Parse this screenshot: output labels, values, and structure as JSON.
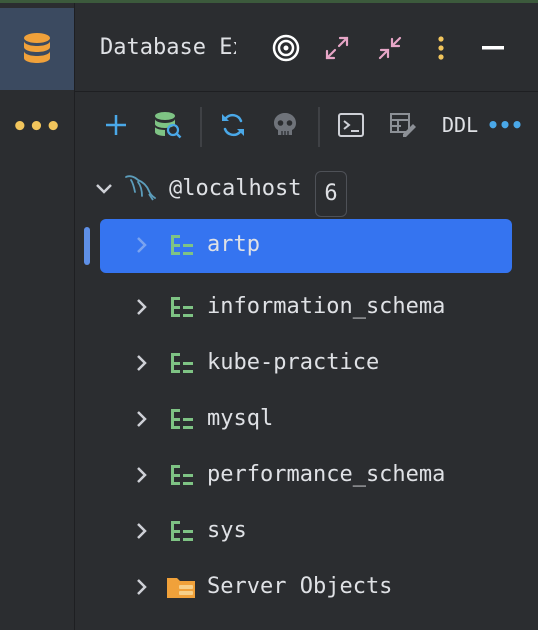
{
  "activity_bar": {
    "more_label": "•••"
  },
  "panel": {
    "title": "Database Explorer",
    "header_icons": [
      "target-icon",
      "expand-icon",
      "collapse-icon",
      "kebab-icon",
      "minimize-icon"
    ]
  },
  "toolbar": {
    "ddl_label": "DDL",
    "more_label": "•••"
  },
  "tree": {
    "connection": {
      "label": "@localhost",
      "count": "6"
    },
    "schemas": [
      {
        "label": "artp",
        "selected": true
      },
      {
        "label": "information_schema",
        "selected": false
      },
      {
        "label": "kube-practice",
        "selected": false
      },
      {
        "label": "mysql",
        "selected": false
      },
      {
        "label": "performance_schema",
        "selected": false
      },
      {
        "label": "sys",
        "selected": false
      }
    ],
    "server_objects": {
      "label": "Server Objects"
    }
  },
  "colors": {
    "background": "#2b2d30",
    "selection": "#3574f0",
    "accent_blue": "#4aa8e8",
    "accent_green": "#7ec384",
    "accent_orange": "#f0a13a",
    "accent_pink": "#e7a6c7"
  }
}
